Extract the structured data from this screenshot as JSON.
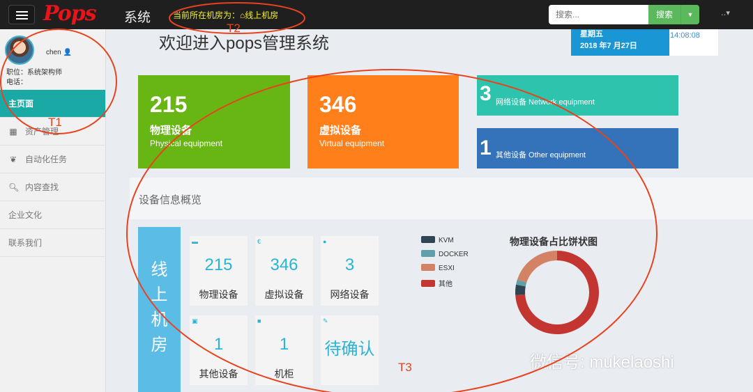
{
  "topbar": {
    "logo": "Pops",
    "system_label": "系统",
    "current_room_label": "当前所在机房为：",
    "current_room": "线上机房",
    "search_placeholder": "搜索...",
    "search_button": "搜索",
    "user_menu": "‥▾"
  },
  "sidebar": {
    "username": "chen",
    "position": "职位：系统架构师",
    "phone": "电话：",
    "nav": [
      {
        "label": "主页面",
        "icon": "",
        "active": true
      },
      {
        "label": "资产管理",
        "icon": "grid-icon"
      },
      {
        "label": "自动化任务",
        "icon": "leaf-icon"
      },
      {
        "label": "内容查找",
        "icon": "search-icon"
      },
      {
        "label": "企业文化",
        "icon": ""
      },
      {
        "label": "联系我们",
        "icon": ""
      }
    ]
  },
  "main": {
    "welcome": "欢迎进入pops管理系统",
    "weekday": "星期五",
    "date": "2018 年7 月27日",
    "time": "14:08:08",
    "tiles": [
      {
        "num": "215",
        "cn": "物理设备",
        "en": "Physical equipment",
        "color": "#68b613"
      },
      {
        "num": "346",
        "cn": "虚拟设备",
        "en": "Virtual equipment",
        "color": "#ff7f1a"
      },
      {
        "num": "3",
        "label": "网络设备 Network equipment",
        "color": "#2ec3ad"
      },
      {
        "num": "1",
        "label": "其他设备 Other equipment",
        "color": "#3472b9"
      }
    ],
    "section_title": "设备信息概览",
    "room_name": "线上机房",
    "cards": [
      {
        "value": "215",
        "label": "物理设备",
        "icon": "server-icon",
        "glyph": "▬"
      },
      {
        "value": "346",
        "label": "虚拟设备",
        "icon": "euro-icon",
        "glyph": "€"
      },
      {
        "value": "3",
        "label": "网络设备",
        "icon": "globe-icon",
        "glyph": "●"
      },
      {
        "value": "1",
        "label": "其他设备",
        "icon": "hdd-icon",
        "glyph": "▣"
      },
      {
        "value": "1",
        "label": "机柜",
        "icon": "stop-icon",
        "glyph": "■"
      },
      {
        "value": "待确认",
        "label": "",
        "icon": "pushpin-icon",
        "glyph": "✎"
      }
    ]
  },
  "chart_data": {
    "type": "pie",
    "title": "物理设备占比饼状图",
    "donut": true,
    "legend": "left",
    "categories": [
      "KVM",
      "DOCKER",
      "ESXI",
      "其他"
    ],
    "values": [
      4,
      2,
      20,
      74
    ],
    "unit": "percent (estimated)",
    "colors": [
      "#2f4554",
      "#61a0a8",
      "#d48265",
      "#c23531"
    ]
  },
  "annotations": {
    "t1": "T1",
    "t2": "T2",
    "t3": "T3"
  },
  "watermark": "微信号: mukelaoshi"
}
